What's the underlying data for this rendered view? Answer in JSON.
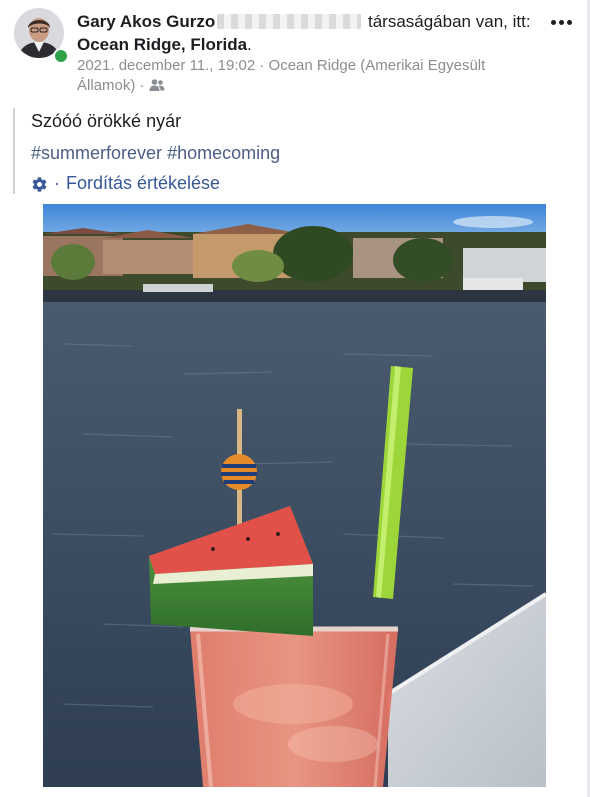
{
  "post": {
    "author": "Gary Akos Gurzo",
    "with_suffix": "társaságában",
    "location_prefix": "van, itt:",
    "location": "Ocean Ridge, Florida",
    "location_end": ".",
    "date": "2021. december 11., 19:02",
    "meta_separator": "·",
    "meta_place": "Ocean Ridge (Amerikai Egyesült Államok)",
    "meta_separator_2": "·",
    "text": "Szóóó örökké nyár",
    "hashtags": [
      "#summerforever",
      "#homecoming"
    ],
    "translate_separator": "·",
    "translate_label": "Fordítás értékelése"
  },
  "icons": {
    "more": "more-options-icon",
    "audience": "friends-icon",
    "translate": "gear-icon",
    "status": "online-status-icon"
  },
  "colors": {
    "link": "#385898",
    "hashtag": "#4b5e86",
    "meta": "#8a8d91",
    "online": "#31a24c"
  }
}
